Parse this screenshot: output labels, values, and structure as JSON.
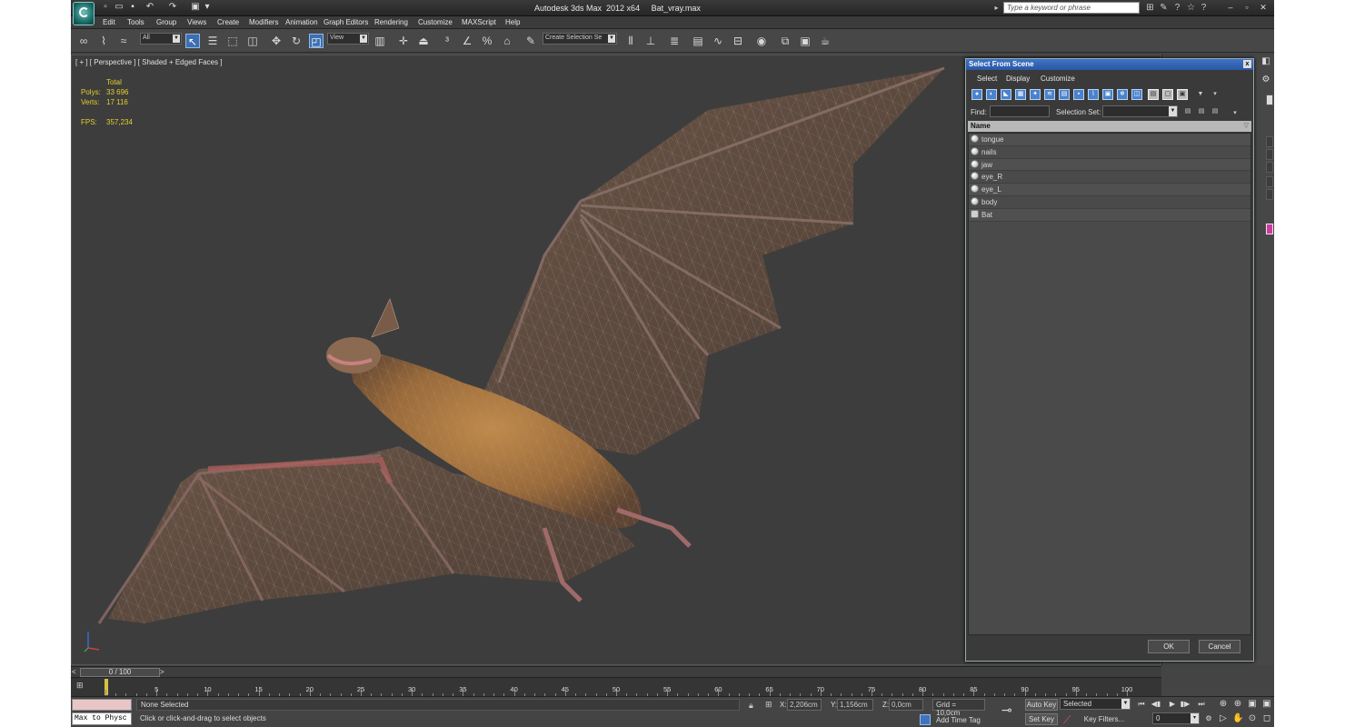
{
  "window": {
    "title": "Autodesk 3ds Max  2012 x64     Bat_vray.max",
    "search_placeholder": "Type a keyword or phrase"
  },
  "menu": [
    "Edit",
    "Tools",
    "Group",
    "Views",
    "Create",
    "Modifiers",
    "Animation",
    "Graph Editors",
    "Rendering",
    "Customize",
    "MAXScript",
    "Help"
  ],
  "toolbar": {
    "selection_filter": "All",
    "reference_coord": "View",
    "named_selection": "Create Selection Se"
  },
  "viewport": {
    "label": "[ + ] [ Perspective ] [ Shaded + Edged Faces ]",
    "stats": {
      "header": "Total",
      "polys_label": "Polys:",
      "polys": "33 696",
      "verts_label": "Verts:",
      "verts": "17 116",
      "fps_label": "FPS:",
      "fps": "357,234"
    }
  },
  "dialog": {
    "title": "Select From Scene",
    "close": "x",
    "menu": [
      "Select",
      "Display",
      "Customize"
    ],
    "find_label": "Find:",
    "find_value": "",
    "selection_set_label": "Selection Set:",
    "selection_set_value": "",
    "column_header": "Name",
    "objects": [
      "tongue",
      "nails",
      "jaw",
      "eye_R",
      "eye_L",
      "body",
      "Bat"
    ],
    "ok": "OK",
    "cancel": "Cancel"
  },
  "time_slider": {
    "prev": "<",
    "position": "0 / 100",
    "next": ">"
  },
  "timeline": {
    "labels": [
      "5",
      "10",
      "15",
      "20",
      "25",
      "30",
      "35",
      "40",
      "45",
      "50",
      "55",
      "60",
      "65",
      "70",
      "75",
      "80",
      "85",
      "90",
      "95",
      "100"
    ]
  },
  "status": {
    "maxscript": "Max to Physc",
    "line1": "None Selected",
    "line2": "Click or click-and-drag to select objects",
    "x_label": "X:",
    "x_value": "2,206cm",
    "y_label": "Y:",
    "y_value": "1,156cm",
    "z_label": "Z:",
    "z_value": "0,0cm",
    "grid": "Grid = 10,0cm",
    "add_time_tag": "Add Time Tag",
    "auto_key": "Auto Key",
    "set_key": "Set Key",
    "selected": "Selected",
    "key_filters": "Key Filters...",
    "frame": "0"
  },
  "colors": {
    "ui_background": "#444444",
    "viewport": "#3d3d3d",
    "stats_text": "#e4d02a",
    "dialog_title": "#2f5faf",
    "active_tool": "#3d6fb0"
  }
}
